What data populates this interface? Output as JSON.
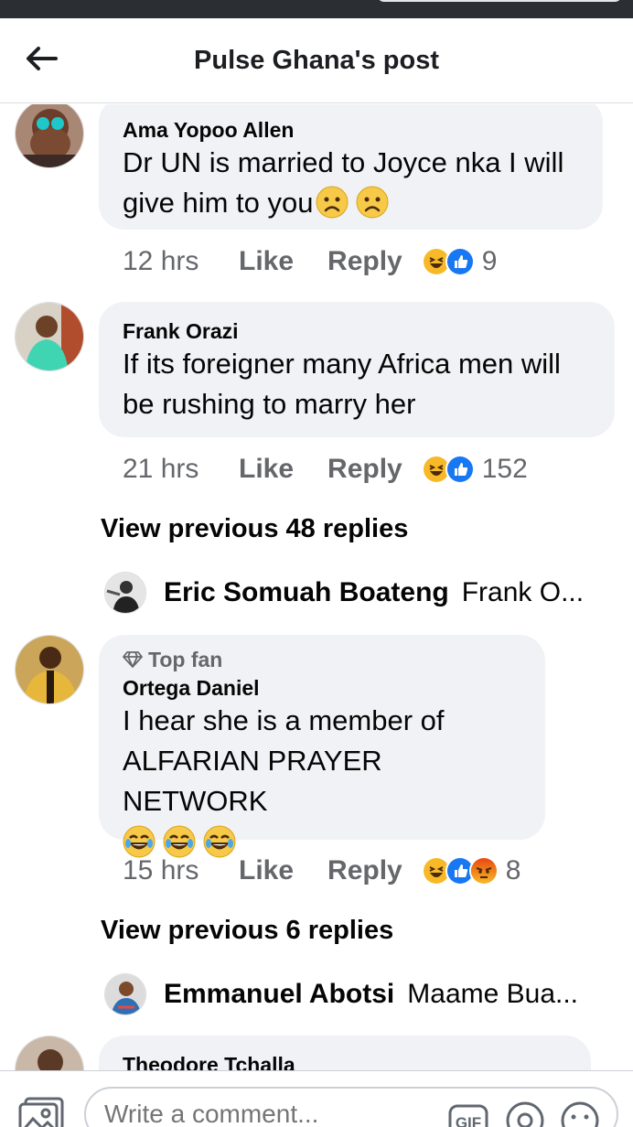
{
  "header": {
    "title": "Pulse Ghana's post"
  },
  "comments": [
    {
      "author": "Ama Yopoo Allen",
      "text": "Dr UN is married to Joyce nka I will give him to you",
      "emoji": [
        "sad",
        "sad"
      ],
      "time": "12 hrs",
      "like": "Like",
      "reply": "Reply",
      "reactions": [
        "haha",
        "like"
      ],
      "reaction_count": "9"
    },
    {
      "author": "Frank Orazi",
      "text": "If its foreigner many Africa men will be rushing to marry her",
      "time": "21 hrs",
      "like": "Like",
      "reply": "Reply",
      "reactions": [
        "haha",
        "like"
      ],
      "reaction_count": "152",
      "view_previous": "View previous 48 replies",
      "latest_reply": {
        "author": "Eric Somuah Boateng",
        "text": "Frank O..."
      }
    },
    {
      "badge": "Top fan",
      "author": "Ortega Daniel",
      "text_line1": "I hear she is a member of",
      "text_line2": "ALFARIAN PRAYER NETWORK",
      "emoji": [
        "joy",
        "joy",
        "joy"
      ],
      "time": "15 hrs",
      "like": "Like",
      "reply": "Reply",
      "reactions": [
        "haha",
        "like",
        "angry"
      ],
      "reaction_count": "8",
      "view_previous": "View previous 6 replies",
      "latest_reply": {
        "author": "Emmanuel Abotsi",
        "text": "Maame Bua..."
      }
    },
    {
      "author": "Theodore Tchalla"
    }
  ],
  "composer": {
    "placeholder": "Write a comment...",
    "gif_label": "GIF"
  },
  "colors": {
    "bubble": "#f0f2f5",
    "secondary_text": "#65676b",
    "like_blue": "#1877f2",
    "haha_yellow": "#f7b928",
    "angry_orange": "#e9710f"
  }
}
